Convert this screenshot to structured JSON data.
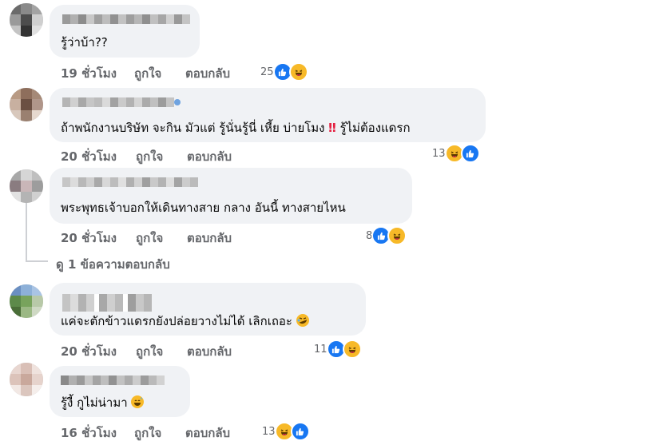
{
  "comments": [
    {
      "text": "รู้ว่าบ้า??",
      "time": "19 ชั่วโมง",
      "like": "ถูกใจ",
      "reply": "ตอบกลับ",
      "reaction_count": "25",
      "reactions": [
        "like-icon",
        "haha-icon"
      ]
    },
    {
      "text_a": "ถ้าพนักงานบริษัท จะกิน มัวแต่ รู้นั่นรู้นี่ เหี้ย บ่ายโมง ",
      "text_b": " รู้ไม่ต้องแดรก",
      "bang": "‼",
      "time": "20 ชั่วโมง",
      "like": "ถูกใจ",
      "reply": "ตอบกลับ",
      "reaction_count": "13",
      "reactions": [
        "haha-icon",
        "like-icon"
      ]
    },
    {
      "text": "พระพุทธเจ้าบอกให้เดินทางสาย กลาง อันนี้ ทางสายไหน",
      "time": "20 ชั่วโมง",
      "like": "ถูกใจ",
      "reply": "ตอบกลับ",
      "reaction_count": "8",
      "reactions": [
        "like-icon",
        "haha-icon"
      ],
      "view_replies": "ดู 1 ข้อความตอบกลับ"
    },
    {
      "text": "แค่จะตักข้าวแดรกยังปล่อยวางไม่ได้ เลิกเถอะ",
      "time": "20 ชั่วโมง",
      "like": "ถูกใจ",
      "reply": "ตอบกลับ",
      "reaction_count": "11",
      "reactions": [
        "like-icon",
        "haha-icon"
      ]
    },
    {
      "text": "รู้งี้ กูไม่น่ามา",
      "time": "16 ชั่วโมง",
      "like": "ถูกใจ",
      "reply": "ตอบกลับ",
      "reaction_count": "13",
      "reactions": [
        "haha-icon",
        "like-icon"
      ]
    }
  ],
  "colors": {
    "like": "#1877f2",
    "haha": "#f7b928",
    "bubble": "#f0f2f5",
    "meta": "#65676b"
  }
}
